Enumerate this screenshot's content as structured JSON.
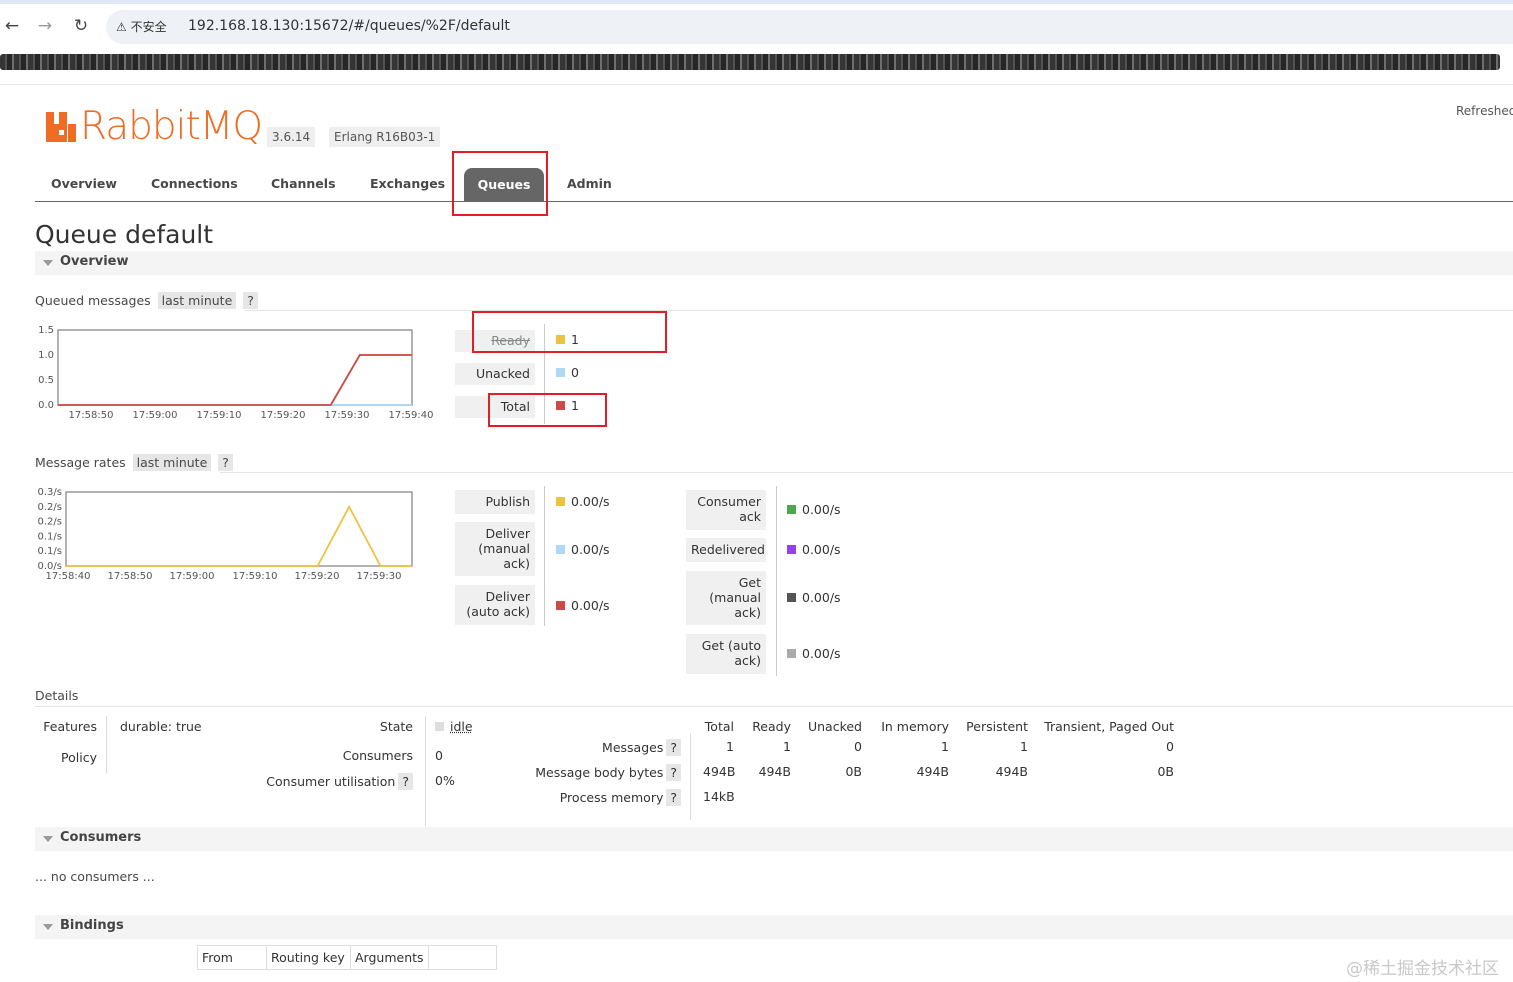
{
  "browser": {
    "security_label": "⚠ 不安全",
    "url": "192.168.18.130:15672/#/queues/%2F/default"
  },
  "app": {
    "logo_text": "RabbitMQ",
    "version": "3.6.14",
    "erlang": "Erlang R16B03-1",
    "refreshed": "Refreshed"
  },
  "nav": {
    "tabs": [
      "Overview",
      "Connections",
      "Channels",
      "Exchanges",
      "Queues",
      "Admin"
    ],
    "active": "Queues"
  },
  "page": {
    "title": "Queue default"
  },
  "overview": {
    "section_title": "Overview",
    "queued": {
      "label": "Queued messages",
      "range": "last minute",
      "help": "?",
      "legend": [
        {
          "label": "Ready",
          "value": "1",
          "color": "#edc240"
        },
        {
          "label": "Unacked",
          "value": "0",
          "color": "#afd8f8"
        },
        {
          "label": "Total",
          "value": "1",
          "color": "#cb4b4b"
        }
      ]
    },
    "rates": {
      "label": "Message rates",
      "range": "last minute",
      "help": "?",
      "legend_left": [
        {
          "label": "Publish",
          "value": "0.00/s",
          "color": "#edc240"
        },
        {
          "label": "Deliver (manual ack)",
          "value": "0.00/s",
          "color": "#afd8f8"
        },
        {
          "label": "Deliver (auto ack)",
          "value": "0.00/s",
          "color": "#cb4b4b"
        }
      ],
      "legend_right": [
        {
          "label": "Consumer ack",
          "value": "0.00/s",
          "color": "#4da74d"
        },
        {
          "label": "Redelivered",
          "value": "0.00/s",
          "color": "#9440ed"
        },
        {
          "label": "Get (manual ack)",
          "value": "0.00/s",
          "color": "#555555"
        },
        {
          "label": "Get (auto ack)",
          "value": "0.00/s",
          "color": "#aaaaaa"
        }
      ]
    }
  },
  "chart_data": [
    {
      "type": "line",
      "title": "Queued messages",
      "x_labels": [
        "17:58:50",
        "17:59:00",
        "17:59:10",
        "17:59:20",
        "17:59:30",
        "17:59:40"
      ],
      "y_ticks": [
        "0.0",
        "0.5",
        "1.0",
        "1.5"
      ],
      "ylim": [
        0,
        1.5
      ],
      "series": [
        {
          "name": "Ready",
          "color": "#edc240",
          "x": [
            "17:58:43",
            "17:59:30",
            "17:59:35",
            "17:59:44"
          ],
          "values": [
            0,
            0,
            1,
            1
          ]
        },
        {
          "name": "Unacked",
          "color": "#afd8f8",
          "x": [
            "17:58:43",
            "17:59:44"
          ],
          "values": [
            0,
            0
          ]
        },
        {
          "name": "Total",
          "color": "#cb4b4b",
          "x": [
            "17:58:43",
            "17:59:30",
            "17:59:35",
            "17:59:44"
          ],
          "values": [
            0,
            0,
            1,
            1
          ]
        }
      ]
    },
    {
      "type": "line",
      "title": "Message rates",
      "x_labels": [
        "17:58:40",
        "17:58:50",
        "17:59:00",
        "17:59:10",
        "17:59:20",
        "17:59:30"
      ],
      "y_ticks": [
        "0.0/s",
        "0.1/s",
        "0.1/s",
        "0.2/s",
        "0.2/s",
        "0.3/s"
      ],
      "ylim": [
        0,
        0.25
      ],
      "series": [
        {
          "name": "Publish",
          "color": "#edc240",
          "x": [
            "17:58:40",
            "17:59:20",
            "17:59:25",
            "17:59:30",
            "17:59:35"
          ],
          "values": [
            0,
            0,
            0.2,
            0,
            0
          ]
        }
      ]
    }
  ],
  "details": {
    "label": "Details",
    "features_label": "Features",
    "features_value": "durable: true",
    "policy_label": "Policy",
    "state_label": "State",
    "state_value": "idle",
    "consumers_label": "Consumers",
    "consumers_value": "0",
    "util_label": "Consumer utilisation",
    "util_value": "0%",
    "help": "?",
    "table": {
      "headers": [
        "Total",
        "Ready",
        "Unacked",
        "In memory",
        "Persistent",
        "Transient, Paged Out"
      ],
      "rows": [
        {
          "label": "Messages",
          "cells": [
            "1",
            "1",
            "0",
            "1",
            "1",
            "0"
          ]
        },
        {
          "label": "Message body bytes",
          "cells": [
            "494B",
            "494B",
            "0B",
            "494B",
            "494B",
            "0B"
          ]
        },
        {
          "label": "Process memory",
          "cells": [
            "14kB",
            "",
            "",
            "",
            "",
            ""
          ]
        }
      ]
    }
  },
  "consumers": {
    "section_title": "Consumers",
    "empty_text": "... no consumers ..."
  },
  "bindings": {
    "section_title": "Bindings",
    "headers": [
      "From",
      "Routing key",
      "Arguments",
      ""
    ]
  },
  "watermark": "@稀土掘金技术社区"
}
